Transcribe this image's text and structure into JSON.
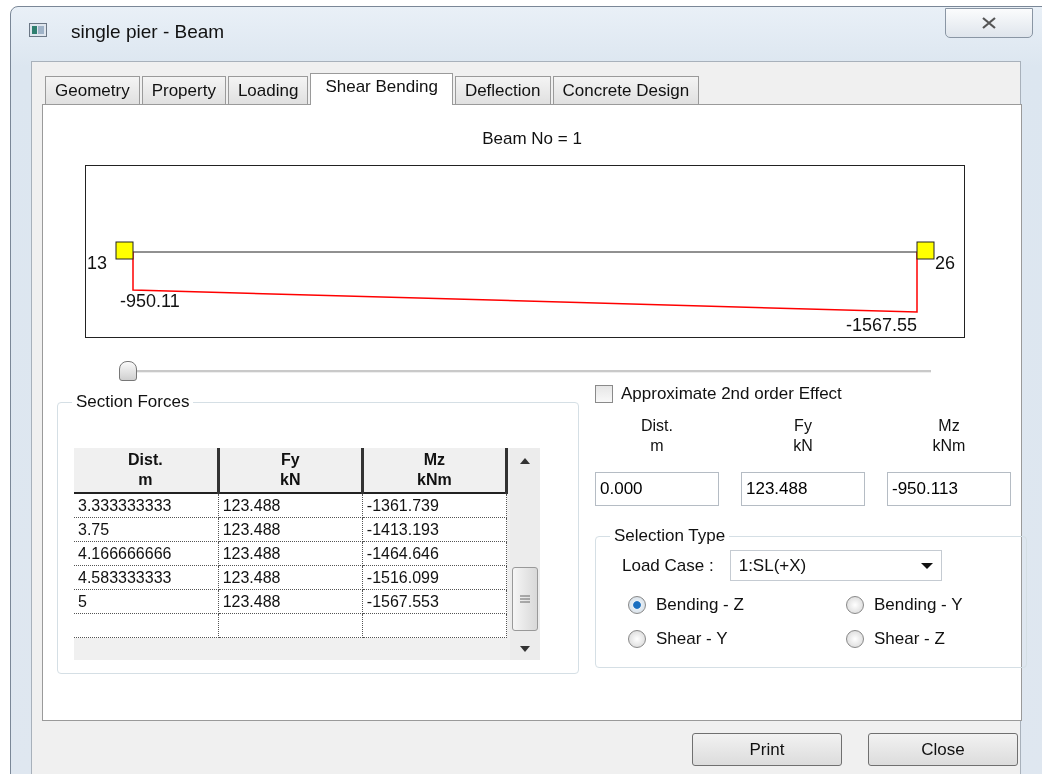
{
  "window": {
    "title": "single pier - Beam"
  },
  "tabs": [
    {
      "label": "Geometry",
      "selected": false
    },
    {
      "label": "Property",
      "selected": false
    },
    {
      "label": "Loading",
      "selected": false
    },
    {
      "label": "Shear Bending",
      "selected": true
    },
    {
      "label": "Deflection",
      "selected": false
    },
    {
      "label": "Concrete Design",
      "selected": false
    }
  ],
  "beam_no": "Beam No = 1",
  "diagram": {
    "start_node": "13",
    "end_node": "26",
    "start_value": "-950.11",
    "end_value": "-1567.55"
  },
  "slider": {
    "level": 0
  },
  "section_forces": {
    "title": "Section Forces",
    "columns": [
      {
        "name": "Dist.",
        "unit": "m"
      },
      {
        "name": "Fy",
        "unit": "kN"
      },
      {
        "name": "Mz",
        "unit": "kNm"
      }
    ],
    "rows": [
      [
        "3.333333333",
        "123.488",
        "-1361.739"
      ],
      [
        "3.75",
        "123.488",
        "-1413.193"
      ],
      [
        "4.166666666",
        "123.488",
        "-1464.646"
      ],
      [
        "4.583333333",
        "123.488",
        "-1516.099"
      ],
      [
        "5",
        "123.488",
        "-1567.553"
      ]
    ]
  },
  "second_order": {
    "label": "Approximate 2nd order Effect",
    "checked": false
  },
  "current": {
    "columns": [
      {
        "name": "Dist.",
        "unit": "m"
      },
      {
        "name": "Fy",
        "unit": "kN"
      },
      {
        "name": "Mz",
        "unit": "kNm"
      }
    ],
    "values": [
      "0.000",
      "123.488",
      "-950.113"
    ]
  },
  "selection_type": {
    "title": "Selection Type",
    "load_case_label": "Load Case :",
    "load_case": "1:SL(+X)",
    "options": [
      {
        "label": "Bending - Z",
        "selected": true
      },
      {
        "label": "Bending - Y",
        "selected": false
      },
      {
        "label": "Shear - Y",
        "selected": false
      },
      {
        "label": "Shear - Z",
        "selected": false
      }
    ]
  },
  "buttons": [
    "Print",
    "Close"
  ]
}
